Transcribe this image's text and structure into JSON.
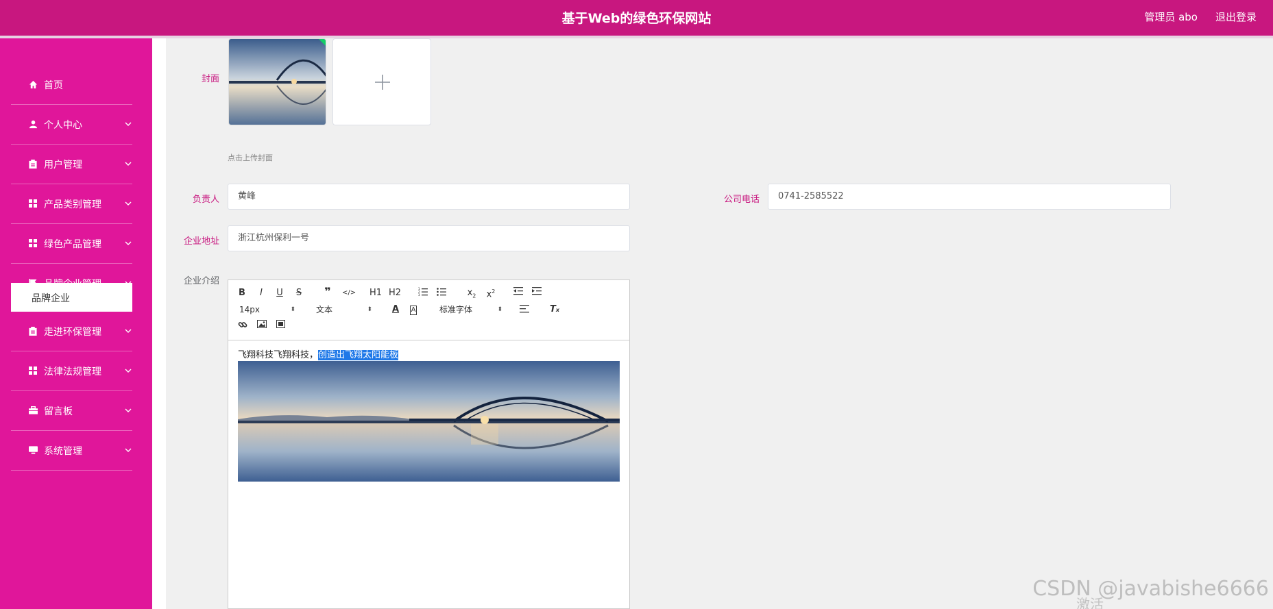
{
  "header": {
    "title": "基于Web的绿色环保网站",
    "user": "管理员 abo",
    "logout": "退出登录"
  },
  "sidebar": {
    "items": [
      {
        "label": "首页",
        "icon": "home-icon",
        "has_arrow": false
      },
      {
        "label": "个人中心",
        "icon": "user-icon",
        "has_arrow": true
      },
      {
        "label": "用户管理",
        "icon": "clipboard-icon",
        "has_arrow": true
      },
      {
        "label": "产品类别管理",
        "icon": "grid-icon",
        "has_arrow": true
      },
      {
        "label": "绿色产品管理",
        "icon": "grid-icon",
        "has_arrow": true
      },
      {
        "label": "品牌企业管理",
        "icon": "flag-icon",
        "has_arrow": true
      },
      {
        "label": "走进环保管理",
        "icon": "clipboard-icon",
        "has_arrow": true
      },
      {
        "label": "法律法规管理",
        "icon": "grid-icon",
        "has_arrow": true
      },
      {
        "label": "留言板",
        "icon": "briefcase-icon",
        "has_arrow": true
      },
      {
        "label": "系统管理",
        "icon": "monitor-icon",
        "has_arrow": true
      }
    ],
    "active_sub": "品牌企业"
  },
  "form": {
    "cover_label": "封面",
    "cover_hint": "点击上传封面",
    "manager_label": "负责人",
    "manager_value": "黄峰",
    "phone_label": "公司电话",
    "phone_value": "0741-2585522",
    "address_label": "企业地址",
    "address_value": "浙江杭州保利一号",
    "intro_label": "企业介绍"
  },
  "editor": {
    "toolbar": {
      "font_size": "14px",
      "block_type": "文本",
      "font_family": "标准字体",
      "h1": "H1",
      "h2": "H2"
    },
    "text_plain": "飞翔科技飞翔科技，",
    "text_selected": "创造出飞翔太阳能板"
  },
  "watermark": "CSDN @javabishe6666",
  "watermark2": "激活"
}
